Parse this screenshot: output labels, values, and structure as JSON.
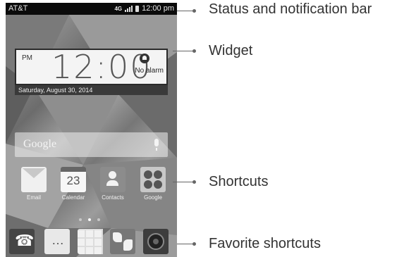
{
  "status_bar": {
    "carrier": "AT&T",
    "network": "4G",
    "time": "12:00 pm"
  },
  "widget": {
    "ampm": "PM",
    "time": "12:00",
    "alarm_status": "No alarm",
    "date": "Saturday, August 30, 2014"
  },
  "search": {
    "label": "Google",
    "icon": "mic-icon"
  },
  "shortcuts": [
    {
      "label": "Email",
      "icon": "email-icon"
    },
    {
      "label": "Calendar",
      "icon": "calendar-icon",
      "badge": "23"
    },
    {
      "label": "Contacts",
      "icon": "contacts-icon"
    },
    {
      "label": "Google",
      "icon": "google-folder-icon"
    }
  ],
  "favorites": [
    {
      "icon": "phone-icon"
    },
    {
      "icon": "messaging-icon"
    },
    {
      "icon": "apps-icon"
    },
    {
      "icon": "browser-icon"
    },
    {
      "icon": "camera-icon"
    }
  ],
  "page_indicator": {
    "pages": 3,
    "active": 2
  },
  "callouts": {
    "status_bar": "Status and notification bar",
    "widget": "Widget",
    "shortcuts": "Shortcuts",
    "favorites": "Favorite shortcuts"
  }
}
